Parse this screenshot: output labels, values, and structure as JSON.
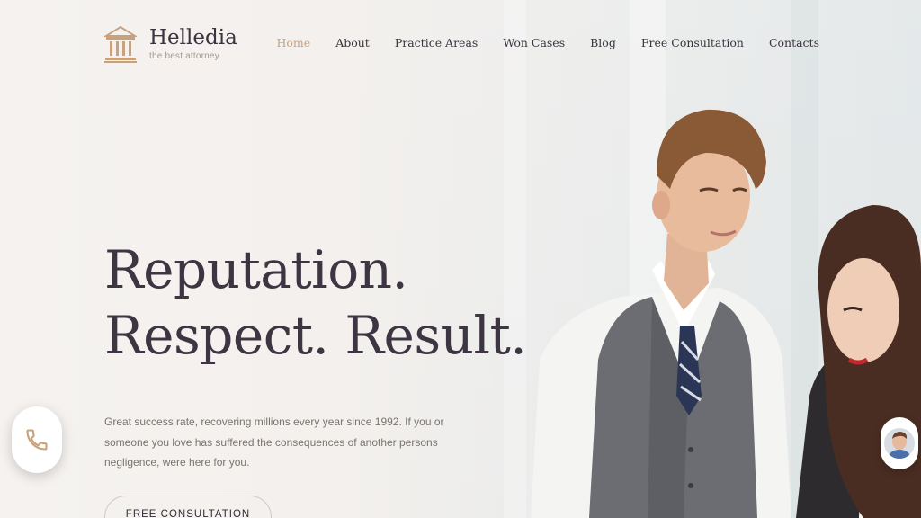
{
  "brand": {
    "name": "Helledia",
    "tagline": "the best attorney",
    "accent_color": "#c9a27c",
    "icon": "courthouse-icon"
  },
  "nav": {
    "items": [
      {
        "label": "Home",
        "active": true
      },
      {
        "label": "About",
        "active": false
      },
      {
        "label": "Practice Areas",
        "active": false
      },
      {
        "label": "Won Cases",
        "active": false
      },
      {
        "label": "Blog",
        "active": false
      },
      {
        "label": "Free Consultation",
        "active": false
      },
      {
        "label": "Contacts",
        "active": false
      }
    ]
  },
  "hero": {
    "headline_line1": "Reputation.",
    "headline_line2": "Respect. Result.",
    "intro": "Great success rate, recovering millions every year since 1992. If you or someone you love has suffered the consequences of another persons negligence, were here for you.",
    "cta_label": "FREE CONSULTATION"
  },
  "floating": {
    "call_icon": "phone-icon",
    "chat_icon": "avatar-icon"
  }
}
